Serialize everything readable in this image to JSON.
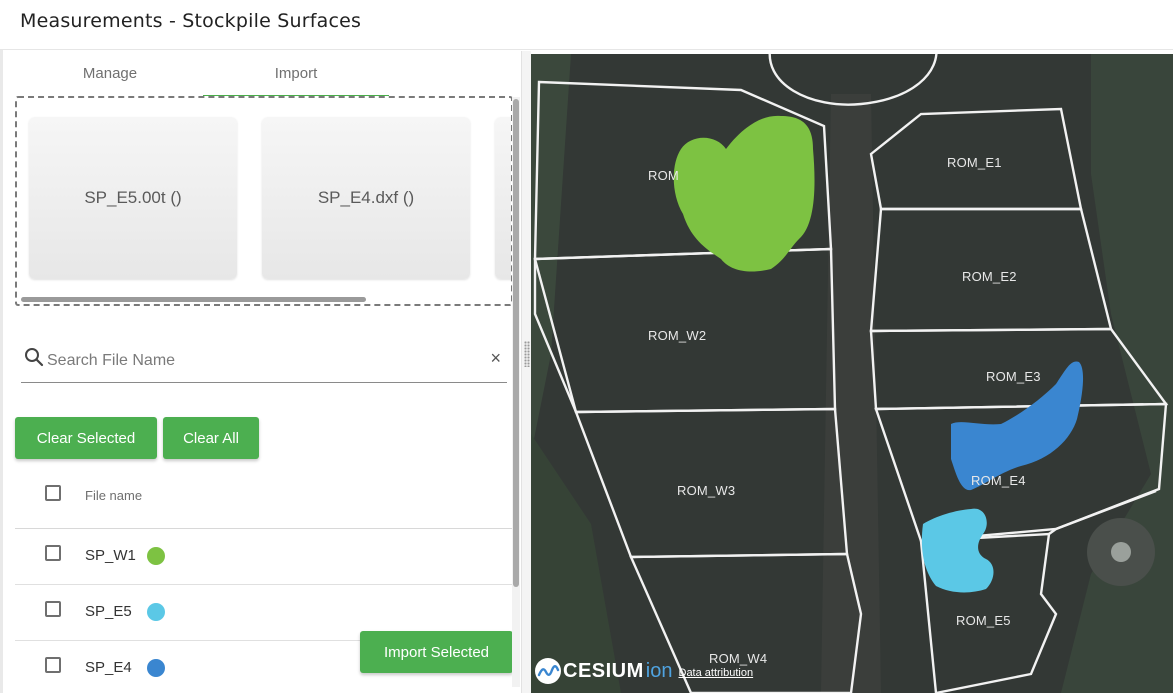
{
  "header": {
    "title": "Measurements - Stockpile Surfaces"
  },
  "tabs": [
    {
      "label": "Manage"
    },
    {
      "label": "Import"
    }
  ],
  "files": [
    {
      "label": "SP_E5.00t ()"
    },
    {
      "label": "SP_E4.dxf ()"
    }
  ],
  "search": {
    "placeholder": "Search File Name",
    "clear": "×"
  },
  "buttons": {
    "clear_selected": "Clear Selected",
    "clear_all": "Clear All",
    "import_selected": "Import Selected"
  },
  "table": {
    "header": "File name",
    "rows": [
      {
        "name": "SP_W1",
        "color": "#7dc242"
      },
      {
        "name": "SP_E5",
        "color": "#5bc8e6"
      },
      {
        "name": "SP_E4",
        "color": "#3a86d0"
      }
    ]
  },
  "map": {
    "zones": [
      "ROM",
      "ROM_E1",
      "ROM_E2",
      "ROM_W2",
      "ROM_E3",
      "ROM_E4",
      "ROM_W3",
      "ROM_E5",
      "ROM_W4"
    ],
    "credit": {
      "brand": "CESIUM",
      "ion": "ion",
      "attribution": "Data attribution"
    }
  },
  "colors": {
    "accent": "#4caf50",
    "sp_w1": "#7dc242",
    "sp_e5": "#5bc8e6",
    "sp_e4": "#3a86d0"
  }
}
